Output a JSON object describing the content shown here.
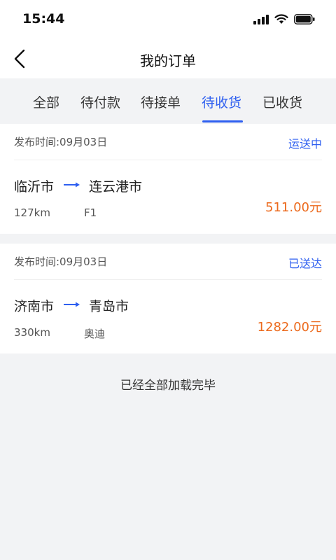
{
  "status_bar": {
    "time": "15:44"
  },
  "nav": {
    "title": "我的订单"
  },
  "tabs": [
    {
      "label": "全部",
      "active": false
    },
    {
      "label": "待付款",
      "active": false
    },
    {
      "label": "待接单",
      "active": false
    },
    {
      "label": "待收货",
      "active": true
    },
    {
      "label": "已收货",
      "active": false
    }
  ],
  "orders": [
    {
      "publish_time": "发布时间:09月03日",
      "status": "运送中",
      "from": "临沂市",
      "to": "连云港市",
      "distance": "127km",
      "vehicle": "F1",
      "price": "511.00元"
    },
    {
      "publish_time": "发布时间:09月03日",
      "status": "已送达",
      "from": "济南市",
      "to": "青岛市",
      "distance": "330km",
      "vehicle": "奥迪",
      "price": "1282.00元"
    }
  ],
  "footer": {
    "end_text": "已经全部加载完毕"
  },
  "colors": {
    "accent": "#2e5ff0",
    "price": "#ec6a1d",
    "background": "#f2f3f5"
  },
  "icons": [
    "signal-icon",
    "wifi-icon",
    "battery-icon",
    "back-arrow-icon",
    "route-arrow-icon"
  ]
}
